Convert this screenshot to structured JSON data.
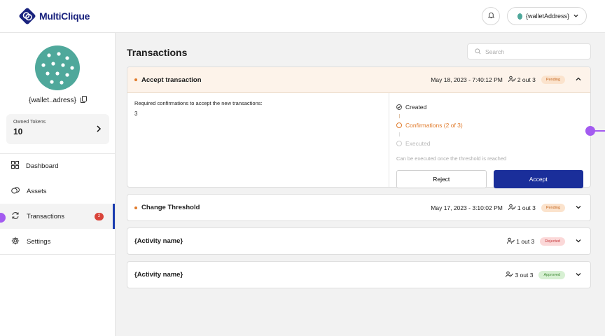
{
  "app": {
    "logo_text": "MultiClique",
    "wallet_label": "{walletAddress}"
  },
  "sidebar": {
    "wallet_short": "{wallet..adress}",
    "owned_tokens_label": "Owned Tokens",
    "owned_tokens_value": "10",
    "nav": [
      {
        "label": "Dashboard",
        "icon": "grid-icon"
      },
      {
        "label": "Assets",
        "icon": "coins-icon"
      },
      {
        "label": "Transactions",
        "icon": "refresh-icon",
        "badge": "2",
        "active": true
      },
      {
        "label": "Settings",
        "icon": "gear-icon"
      }
    ]
  },
  "main": {
    "title": "Transactions",
    "search_placeholder": "Search",
    "transactions": [
      {
        "title": "Accept transaction",
        "date": "May 18, 2023 - 7:40:12 PM",
        "confirmations": "2 out 3",
        "status": "Pending",
        "expanded": true,
        "required_label": "Required confirmations to accept the new transactions:",
        "required_value": "3",
        "steps": [
          "Created",
          "Confirmations (2 of 3)",
          "Executed"
        ],
        "hint": "Can be executed once the threshold is reached",
        "reject_label": "Reject",
        "accept_label": "Accept"
      },
      {
        "title": "Change Threshold",
        "date": "May 17, 2023 - 3:10:02 PM",
        "confirmations": "1 out 3",
        "status": "Pending"
      },
      {
        "title": "{Activity name}",
        "confirmations": "1 out 3",
        "status": "Rejected"
      },
      {
        "title": "{Activity name}",
        "confirmations": "3 out 3",
        "status": "Approved"
      }
    ]
  },
  "colors": {
    "brand": "#1a237e",
    "accent": "#1a2e9a",
    "pending": "#e07a2a",
    "avatar": "#4fa89b",
    "badge": "#d9443a"
  }
}
